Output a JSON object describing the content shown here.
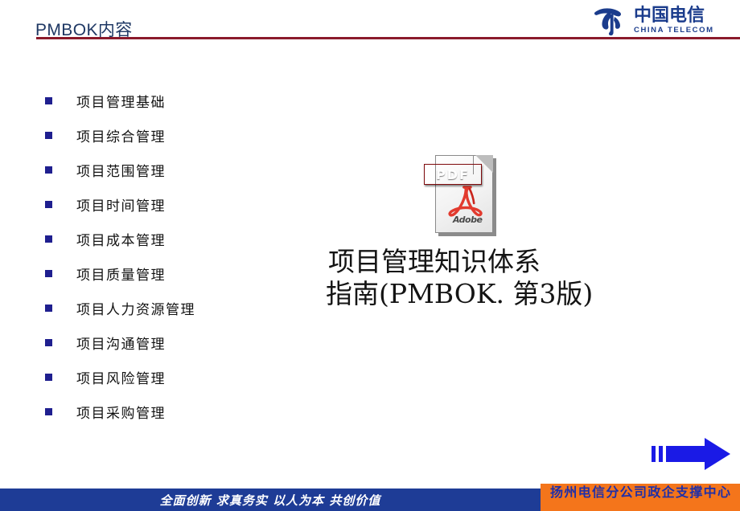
{
  "slide": {
    "title": "PMBOK内容"
  },
  "brand": {
    "logo_mark_name": "china-telecom-emblem",
    "name_cn": "中国电信",
    "name_en": "CHINA TELECOM",
    "color": "#1B3C8C"
  },
  "topics": [
    {
      "label": "项目管理基础"
    },
    {
      "label": "项目综合管理"
    },
    {
      "label": "项目范围管理"
    },
    {
      "label": "项目时间管理"
    },
    {
      "label": "项目成本管理"
    },
    {
      "label": "项目质量管理"
    },
    {
      "label": "项目人力资源管理"
    },
    {
      "label": "项目沟通管理"
    },
    {
      "label": "项目风险管理"
    },
    {
      "label": "项目采购管理"
    }
  ],
  "bullet_color": "#1F1F8F",
  "pdf_icon": {
    "name": "pdf-document-icon",
    "banner_label": "PDF",
    "brand_word": "Adobe",
    "banner_color": "#CF1114"
  },
  "book_caption": {
    "line1": "项目管理知识体系",
    "line2": "指南(PMBOK. 第3版)"
  },
  "arrow": {
    "name": "next-arrow-icon",
    "color": "#1A1AE6"
  },
  "footer": {
    "slogan": "全面创新  求真务实  以人为本  共创价值",
    "slogan_bar_color": "#1E3C96",
    "unit_name": "扬州电信分公司政企支撑中心",
    "unit_block_color": "#F4751B",
    "unit_text_color": "#1F2FA8"
  }
}
